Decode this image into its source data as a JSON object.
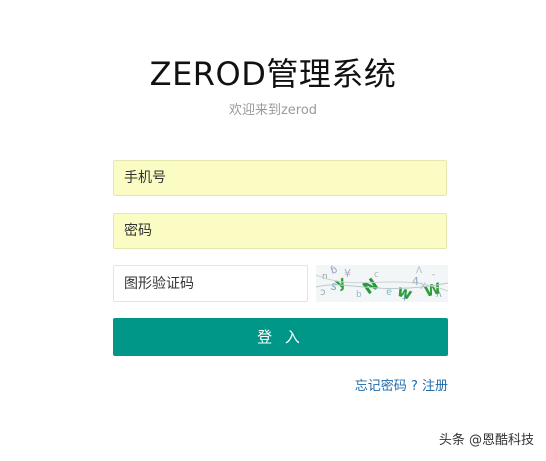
{
  "header": {
    "title": "ZEROD管理系统",
    "subtitle": "欢迎来到zerod"
  },
  "form": {
    "phone_placeholder": "手机号",
    "password_placeholder": "密码",
    "captcha_placeholder": "图形验证码",
    "login_label": "登 入"
  },
  "links": {
    "forgot_password": "忘记密码",
    "separator": "?",
    "register": "注册"
  },
  "watermark": "头条 @恩酷科技",
  "colors": {
    "accent": "#009688",
    "input_autofill_bg": "#fafcc4",
    "link": "#1e6aa8"
  }
}
